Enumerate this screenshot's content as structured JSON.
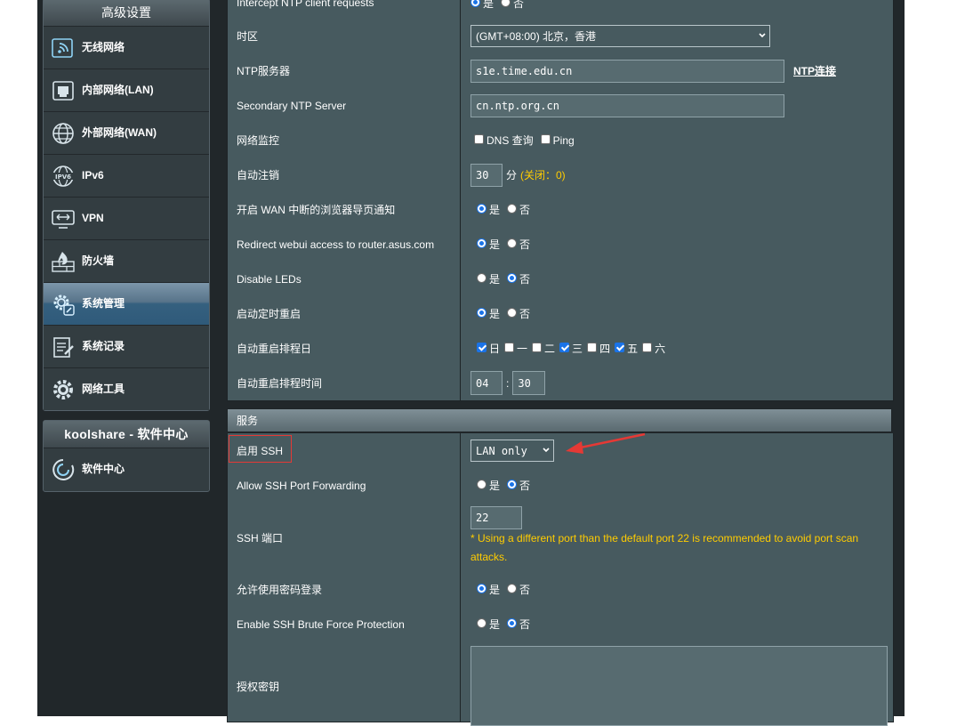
{
  "sidebar": {
    "advanced_title": "高级设置",
    "items": [
      {
        "label": "无线网络",
        "icon": "wireless-icon"
      },
      {
        "label": "内部网络(LAN)",
        "icon": "lan-icon"
      },
      {
        "label": "外部网络(WAN)",
        "icon": "globe-icon"
      },
      {
        "label": "IPv6",
        "icon": "ipv6-icon"
      },
      {
        "label": "VPN",
        "icon": "vpn-icon"
      },
      {
        "label": "防火墙",
        "icon": "firewall-icon"
      },
      {
        "label": "系统管理",
        "icon": "admin-gear-icon",
        "active": true
      },
      {
        "label": "系统记录",
        "icon": "log-icon"
      },
      {
        "label": "网络工具",
        "icon": "tools-gear-icon"
      }
    ],
    "koolshare_title": "koolshare - 软件中心",
    "koolshare_item": {
      "label": "软件中心",
      "icon": "software-center-icon"
    }
  },
  "rows": {
    "intercept_ntp": {
      "label": "Intercept NTP client requests",
      "yes": "是",
      "no": "否",
      "selected": "yes"
    },
    "timezone": {
      "label": "时区",
      "value": "(GMT+08:00) 北京，香港"
    },
    "ntp_server": {
      "label": "NTP服务器",
      "value": "s1e.time.edu.cn",
      "link": "NTP连接"
    },
    "secondary_ntp": {
      "label": "Secondary NTP Server",
      "value": "cn.ntp.org.cn"
    },
    "net_monitor": {
      "label": "网络监控",
      "dns": "DNS 查询",
      "ping": "Ping"
    },
    "auto_logout": {
      "label": "自动注销",
      "value": "30",
      "unit": "分",
      "hint": "(关闭：0)"
    },
    "wan_redirect": {
      "label": "开启 WAN 中断的浏览器导页通知",
      "yes": "是",
      "no": "否",
      "selected": "yes"
    },
    "redirect_webui": {
      "label": "Redirect webui access to router.asus.com",
      "yes": "是",
      "no": "否",
      "selected": "yes"
    },
    "disable_leds": {
      "label": "Disable LEDs",
      "yes": "是",
      "no": "否",
      "selected": "no"
    },
    "scheduled_reboot": {
      "label": "启动定时重启",
      "yes": "是",
      "no": "否",
      "selected": "yes"
    },
    "reboot_days": {
      "label": "自动重启排程日",
      "days": [
        {
          "name": "日",
          "checked": true
        },
        {
          "name": "一",
          "checked": false
        },
        {
          "name": "二",
          "checked": false
        },
        {
          "name": "三",
          "checked": true
        },
        {
          "name": "四",
          "checked": false
        },
        {
          "name": "五",
          "checked": true
        },
        {
          "name": "六",
          "checked": false
        }
      ]
    },
    "reboot_time": {
      "label": "自动重启排程时间",
      "hour": "04",
      "minute": "30",
      "sep": ":"
    }
  },
  "services": {
    "title": "服务",
    "enable_ssh": {
      "label": "启用 SSH",
      "value": "LAN only"
    },
    "ssh_forwarding": {
      "label": "Allow SSH Port Forwarding",
      "yes": "是",
      "no": "否",
      "selected": "no"
    },
    "ssh_port": {
      "label": "SSH 端口",
      "value": "22",
      "note": "* Using a different port than the default port 22 is recommended to avoid port scan attacks."
    },
    "password_login": {
      "label": "允许使用密码登录",
      "yes": "是",
      "no": "否",
      "selected": "yes"
    },
    "brute_force": {
      "label": "Enable SSH Brute Force Protection",
      "yes": "是",
      "no": "否",
      "selected": "no"
    },
    "authorized_keys": {
      "label": "授权密钥",
      "value": ""
    }
  },
  "colors": {
    "accent_radio": "#1a73e8",
    "annotation_red": "#e53935",
    "hint_yellow": "#ffcc00"
  }
}
